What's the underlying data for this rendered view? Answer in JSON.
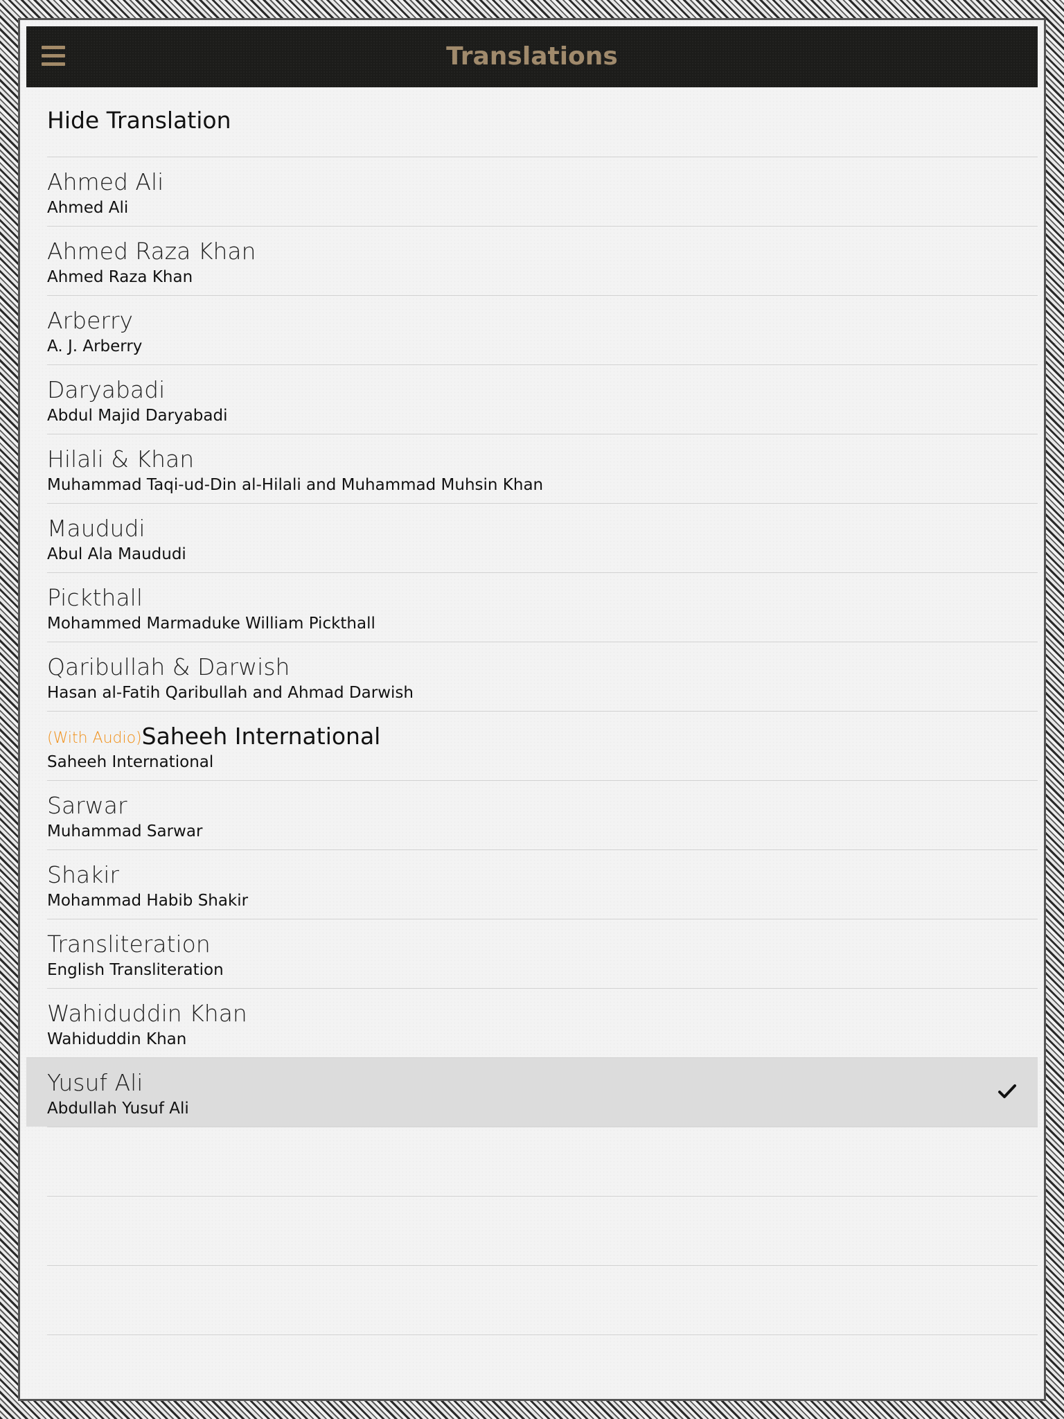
{
  "header": {
    "title": "Translations",
    "menu_icon": "hamburger-menu-icon"
  },
  "hide_translation_label": "Hide Translation",
  "accent_color": "#f0901a",
  "title_color": "#a08a6c",
  "translations": [
    {
      "name": "Ahmed Ali",
      "author": "Ahmed Ali"
    },
    {
      "name": "Ahmed Raza Khan",
      "author": "Ahmed Raza Khan"
    },
    {
      "name": "Arberry",
      "author": "A. J. Arberry"
    },
    {
      "name": "Daryabadi",
      "author": "Abdul Majid Daryabadi"
    },
    {
      "name": "Hilali & Khan",
      "author": "Muhammad Taqi-ud-Din al-Hilali and Muhammad Muhsin Khan"
    },
    {
      "name": "Maududi",
      "author": "Abul Ala Maududi"
    },
    {
      "name": "Pickthall",
      "author": "Mohammed Marmaduke William Pickthall"
    },
    {
      "name": "Qaribullah & Darwish",
      "author": "Hasan al-Fatih Qaribullah and Ahmad Darwish"
    },
    {
      "name": "Saheeh International",
      "author": "Saheeh International",
      "audio_tag": "(With Audio)"
    },
    {
      "name": "Sarwar",
      "author": "Muhammad Sarwar"
    },
    {
      "name": "Shakir",
      "author": "Mohammad Habib Shakir"
    },
    {
      "name": "Transliteration",
      "author": "English Transliteration"
    },
    {
      "name": "Wahiduddin Khan",
      "author": "Wahiduddin Khan"
    },
    {
      "name": "Yusuf Ali",
      "author": "Abdullah Yusuf Ali",
      "selected": true,
      "selected_icon": "checkmark-icon"
    }
  ]
}
